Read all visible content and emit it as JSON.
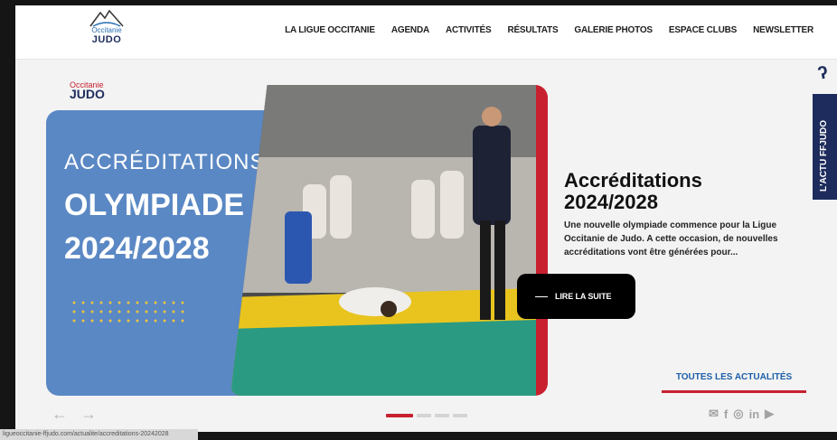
{
  "header": {
    "logo": {
      "occitanie": "Occitanie",
      "judo": "JUDO"
    },
    "nav": [
      "LA LIGUE OCCITANIE",
      "AGENDA",
      "ACTIVITÉS",
      "RÉSULTATS",
      "GALERIE PHOTOS",
      "ESPACE CLUBS",
      "NEWSLETTER"
    ]
  },
  "slide": {
    "badge_occitanie": "Occitanie",
    "badge_judo": "JUDO",
    "poster_line1": "ACCRÉDITATIONS",
    "poster_line2": "OLYMPIADE",
    "poster_line3": "2024/2028",
    "title_line1": "Accréditations",
    "title_line2": "2024/2028",
    "description": "Une nouvelle olympiade commence pour la Ligue Occitanie de Judo. A cette occasion, de nouvelles accréditations vont être générées pour...",
    "read_more": "LIRE LA SUITE"
  },
  "carousel": {
    "prev_arrow": "←",
    "next_arrow": "→",
    "slide_count": 4,
    "active_slide": 1
  },
  "news_link": "TOUTES LES ACTUALITÉS",
  "social_icons": [
    "mail-icon",
    "facebook-icon",
    "instagram-icon",
    "linkedin-icon",
    "youtube-icon"
  ],
  "social_glyphs": {
    "mail": "✉",
    "facebook": "f",
    "instagram": "◎",
    "linkedin": "in",
    "youtube": "▶"
  },
  "side_tab": "L'ACTU FFJUDO",
  "status_url": "ligueoccitanie-ffjudo.com/actualite/accreditations-20242028",
  "colors": {
    "accent_red": "#c8202f",
    "navy": "#1d2c5c",
    "poster_blue": "#5a88c4",
    "link_blue": "#1d5fa8"
  }
}
